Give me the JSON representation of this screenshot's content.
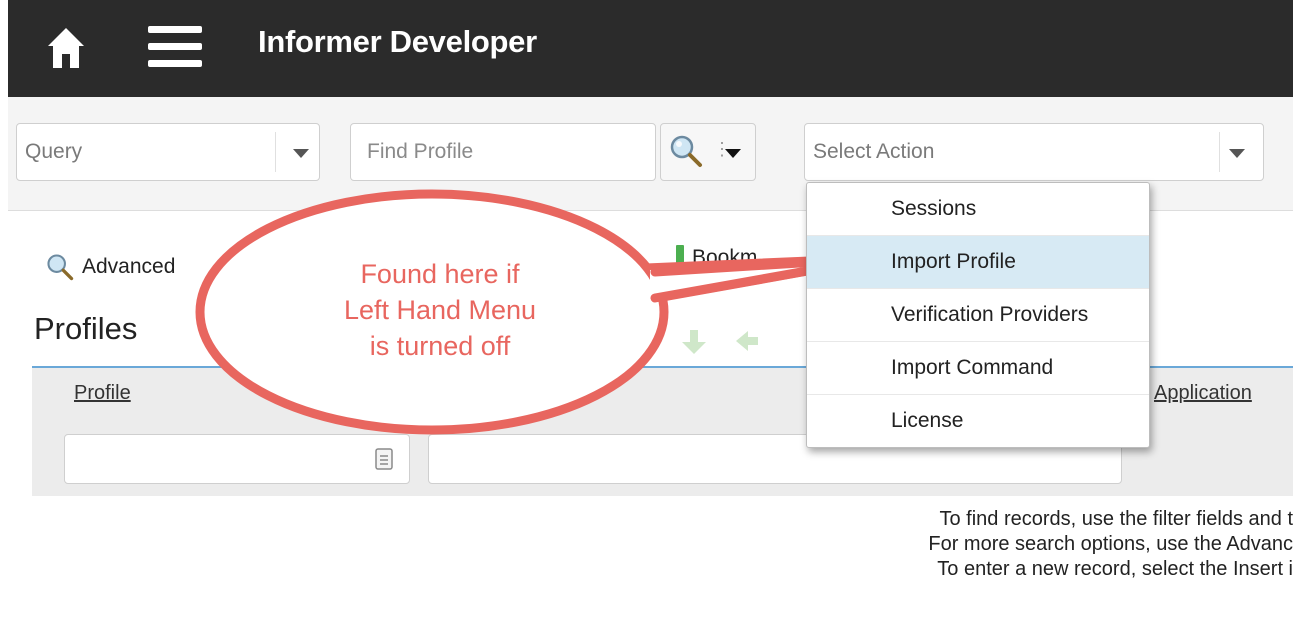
{
  "header": {
    "title": "Informer Developer",
    "home_icon": "home-icon",
    "menu_icon": "hamburger-menu-icon"
  },
  "toolbar": {
    "query_select": "Query",
    "find_placeholder": "Find Profile",
    "action_select": "Select Action"
  },
  "links": {
    "advanced": "Advanced",
    "bookmarks": "Bookm"
  },
  "page": {
    "heading": "Profiles"
  },
  "grid": {
    "columns": [
      "Profile",
      "Application"
    ]
  },
  "empty_message": [
    "To find records, use the filter fields and t",
    "For more search options, use the Advanc",
    "To enter a new record, select the Insert i"
  ],
  "dropdown": {
    "items": [
      "Sessions",
      "Import Profile",
      "Verification Providers",
      "Import Command",
      "License"
    ],
    "selected": "Import Profile"
  },
  "callout": {
    "lines": [
      "Found here if",
      "Left Hand Menu",
      "is turned off"
    ]
  },
  "colors": {
    "topbar": "#2b2b2b",
    "callout": "#e8665f",
    "accent": "#6aa8d8",
    "selected": "#d7eaf4"
  }
}
